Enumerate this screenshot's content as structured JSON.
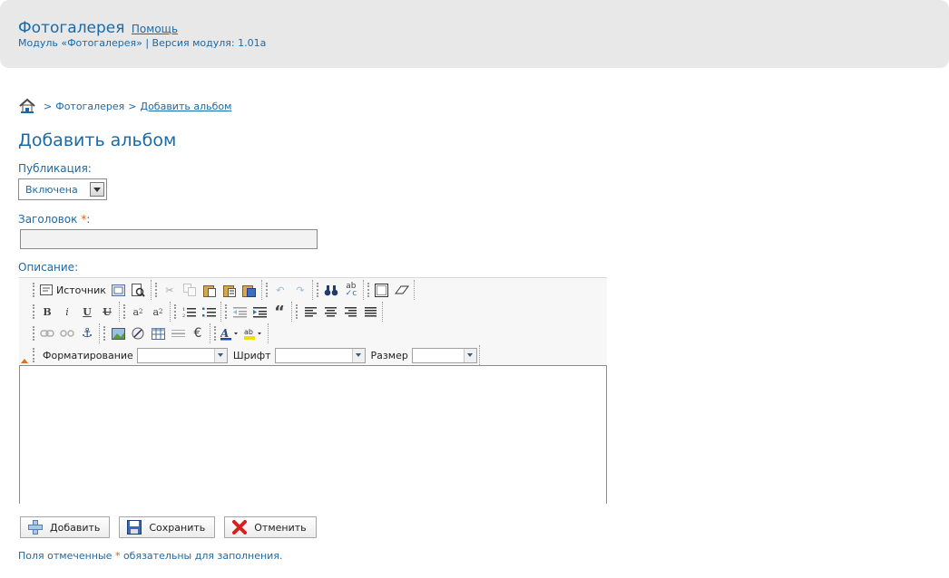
{
  "header": {
    "title": "Фотогалерея",
    "help_link": "Помощь",
    "subtitle": "Модуль «Фотогалерея» | Версия модуля: 1.01a"
  },
  "breadcrumb": {
    "home_icon": "home-icon",
    "separator": ">",
    "items": [
      "Фотогалерея",
      "Добавить альбом"
    ]
  },
  "page_title": "Добавить альбом",
  "form": {
    "publication_label": "Публикация:",
    "publication_value": "Включена",
    "title_label": "Заголовок",
    "required_mark": "*",
    "title_colon": ":",
    "title_value": "",
    "description_label": "Описание:"
  },
  "editor": {
    "source_button": "Источник",
    "format_label": "Форматирование",
    "font_label": "Шрифт",
    "size_label": "Размер",
    "format_value": "",
    "font_value": "",
    "size_value": ""
  },
  "actions": {
    "add": "Добавить",
    "save": "Сохранить",
    "cancel": "Отменить"
  },
  "footnote": {
    "before": "Поля отмеченные",
    "mark": "*",
    "after": "обязательны для заполнения."
  },
  "colors": {
    "accent": "#1a6aa8",
    "required": "#e06010",
    "header_bg": "#e8e8e8"
  }
}
